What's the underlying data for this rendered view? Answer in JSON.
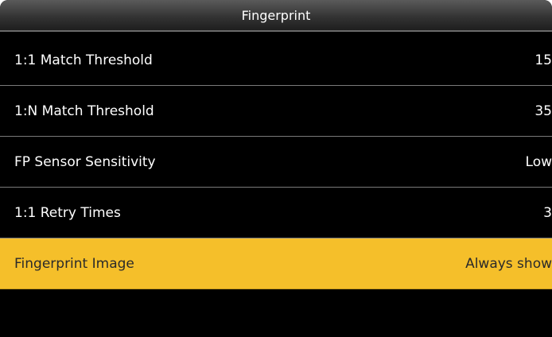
{
  "header": {
    "title": "Fingerprint"
  },
  "menu": {
    "items": [
      {
        "label": "1:1 Match Threshold",
        "value": "15",
        "selected": false
      },
      {
        "label": "1:N Match Threshold",
        "value": "35",
        "selected": false
      },
      {
        "label": "FP Sensor Sensitivity",
        "value": "Low",
        "selected": false
      },
      {
        "label": "1:1 Retry Times",
        "value": "3",
        "selected": false
      },
      {
        "label": "Fingerprint Image",
        "value": "Always show",
        "selected": true
      }
    ]
  },
  "colors": {
    "background": "#000000",
    "highlight": "#f5bf2a",
    "text": "#ffffff",
    "selected_text": "#2a2a2a"
  }
}
